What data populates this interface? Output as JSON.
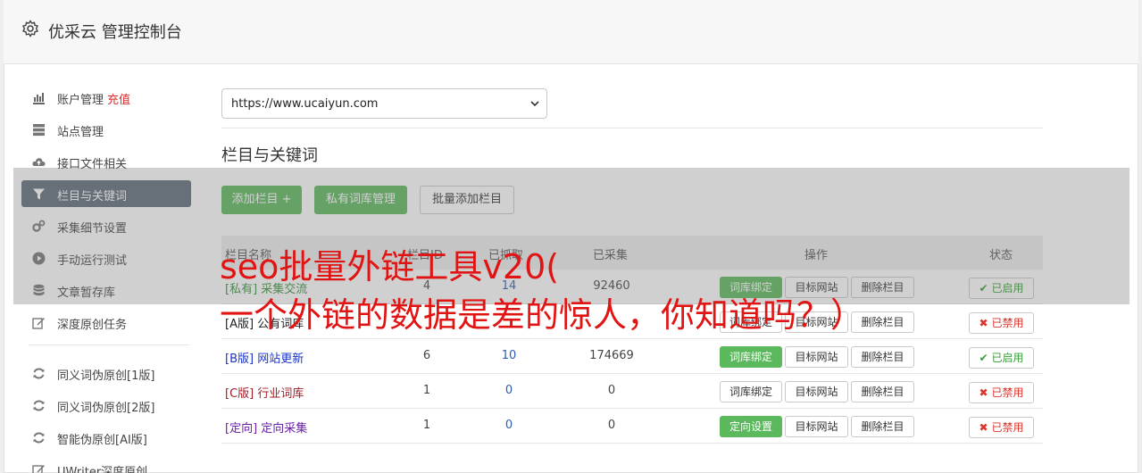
{
  "header": {
    "title": "优采云 管理控制台"
  },
  "sidebar": {
    "items": [
      {
        "label": "账户管理",
        "badge": "充值",
        "icon": "bar-chart-icon"
      },
      {
        "label": "站点管理",
        "icon": "server-icon"
      },
      {
        "label": "接口文件相关",
        "icon": "cloud-upload-icon"
      },
      {
        "label": "栏目与关键词",
        "icon": "filter-icon",
        "active": true
      },
      {
        "label": "采集细节设置",
        "icon": "gears-icon"
      },
      {
        "label": "手动运行测试",
        "icon": "play-circle-icon"
      },
      {
        "label": "文章暂存库",
        "icon": "database-icon"
      },
      {
        "label": "深度原创任务",
        "icon": "edit-icon"
      }
    ],
    "items2": [
      {
        "label": "同义词伪原创[1版]",
        "icon": "refresh-icon"
      },
      {
        "label": "同义词伪原创[2版]",
        "icon": "refresh-icon"
      },
      {
        "label": "智能伪原创[AI版]",
        "icon": "refresh-icon"
      },
      {
        "label": "UWriter深度原创",
        "icon": "edit-icon"
      }
    ]
  },
  "site_select": {
    "value": "https://www.ucaiyun.com"
  },
  "section": {
    "title": "栏目与关键词"
  },
  "toolbar": {
    "add_label": "添加栏目 +",
    "private_label": "私有词库管理",
    "batch_label": "批量添加栏目"
  },
  "table": {
    "headers": {
      "name": "栏目名称",
      "id": "栏目ID",
      "fetch": "已抓取",
      "collected": "已采集",
      "ops": "操作",
      "status": "状态"
    },
    "rows": [
      {
        "tag": "[私有]",
        "name": "采集交流",
        "id": "4",
        "fetch": "14",
        "collected": "92460",
        "bind": "词库绑定",
        "bind_green": true,
        "site": "目标网站",
        "del": "删除栏目",
        "status": "已启用",
        "on": true,
        "color": "#3c8f3c"
      },
      {
        "tag": "[A版]",
        "name": "公有词库",
        "id": "",
        "fetch": "",
        "collected": "",
        "bind": "词库绑定",
        "bind_green": false,
        "site": "目标网站",
        "del": "删除栏目",
        "status": "已禁用",
        "on": false,
        "color": "#222222"
      },
      {
        "tag": "[B版]",
        "name": "网站更新",
        "id": "6",
        "fetch": "10",
        "collected": "174669",
        "bind": "词库绑定",
        "bind_green": true,
        "site": "目标网站",
        "del": "删除栏目",
        "status": "已启用",
        "on": true,
        "color": "#1a33c8"
      },
      {
        "tag": "[C版]",
        "name": "行业词库",
        "id": "1",
        "fetch": "0",
        "collected": "0",
        "bind": "词库绑定",
        "bind_green": false,
        "site": "目标网站",
        "del": "删除栏目",
        "status": "已禁用",
        "on": false,
        "color": "#a0202a"
      },
      {
        "tag": "[定向]",
        "name": "定向采集",
        "id": "1",
        "fetch": "0",
        "collected": "0",
        "bind": "定向设置",
        "bind_green": true,
        "site": "目标网站",
        "del": "删除栏目",
        "status": "已禁用",
        "on": false,
        "color": "#6a1fa8"
      }
    ]
  },
  "overlay": {
    "line1": "seo批量外链工具v20(",
    "line2": "一个外链的数据是差的惊人，你知道吗？）"
  }
}
